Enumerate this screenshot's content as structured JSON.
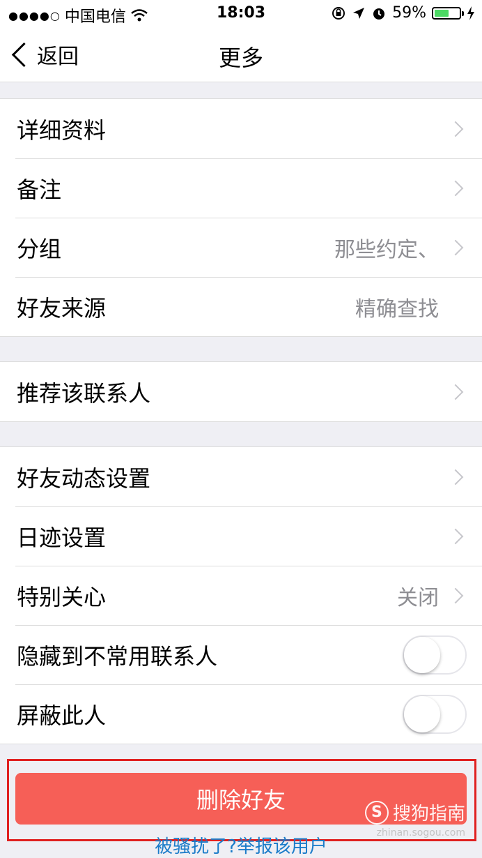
{
  "status_bar": {
    "signal": "●●●●○",
    "carrier": "中国电信",
    "time": "18:03",
    "battery_percent": "59%",
    "battery_level": 0.59
  },
  "nav": {
    "back_label": "返回",
    "title": "更多"
  },
  "groups": [
    {
      "rows": [
        {
          "label": "详细资料",
          "value": "",
          "chevron": true
        },
        {
          "label": "备注",
          "value": "",
          "chevron": true
        },
        {
          "label": "分组",
          "value": "那些约定、",
          "chevron": true
        },
        {
          "label": "好友来源",
          "value": "精确查找",
          "chevron": false
        }
      ]
    },
    {
      "rows": [
        {
          "label": "推荐该联系人",
          "value": "",
          "chevron": true
        }
      ]
    },
    {
      "rows": [
        {
          "label": "好友动态设置",
          "value": "",
          "chevron": true
        },
        {
          "label": "日迹设置",
          "value": "",
          "chevron": true
        },
        {
          "label": "特别关心",
          "value": "关闭",
          "chevron": true
        },
        {
          "label": "隐藏到不常用联系人",
          "toggle": false
        },
        {
          "label": "屏蔽此人",
          "toggle": false
        }
      ]
    }
  ],
  "delete_button": "删除好友",
  "report_link": "被骚扰了?举报该用户",
  "watermark": {
    "logo": "S",
    "text": "搜狗指南",
    "sub": "zhinan.sogou.com"
  },
  "colors": {
    "delete_bg": "#f65f57",
    "link": "#1a7bc9",
    "highlight_border": "#e02020",
    "battery": "#4cd964"
  }
}
